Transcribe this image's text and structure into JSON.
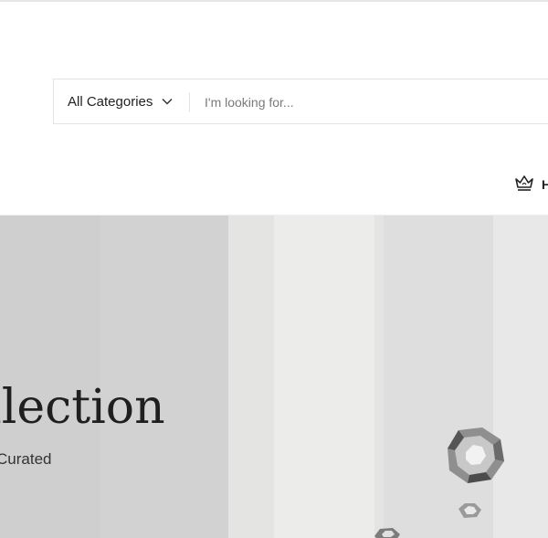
{
  "search": {
    "category_label": "All Categories",
    "placeholder": "I'm looking for..."
  },
  "header": {
    "crown_text": "H"
  },
  "hero": {
    "title": "Collection",
    "subtitle": "Curated"
  },
  "icons": {
    "category_chevron": "chevron-down-icon",
    "crown": "crown-icon"
  },
  "colors": {
    "text": "#1f1f1f",
    "border": "#e3e3e3",
    "hero_bg": "#dcdcdc"
  }
}
